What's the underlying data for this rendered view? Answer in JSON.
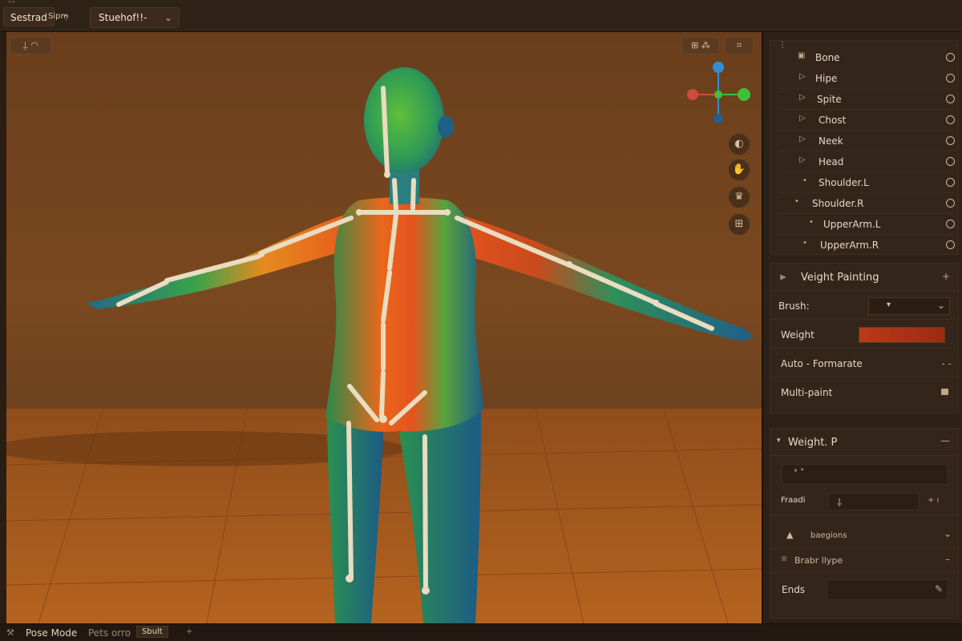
{
  "topbar": {
    "tiny_label": "ᴿᴸᴮ",
    "app_label": "Sestrad",
    "sub_label": "Sipm̴̦",
    "dropdown_value": "Stuehof!!-"
  },
  "viewport": {
    "tl_button_label": "⍊ ◠",
    "tr_button_1": "⊞ ⁂",
    "tr_button_2": "⌗",
    "tools": [
      "◐",
      "✋",
      "♛",
      "⊞"
    ],
    "colors": {
      "axis_x": "#e04a3a",
      "axis_y": "#3fbf3a",
      "axis_z": "#2f8fd6",
      "weight_hot": "#e5531c",
      "weight_mid": "#3aa54a",
      "weight_cold": "#1f5f8a",
      "bone": "#e9dcc0"
    }
  },
  "outliner": {
    "header_mark": "⋮",
    "items": [
      {
        "label": "Bone",
        "mark": "▣"
      },
      {
        "label": "Hipe",
        "mark": "▷"
      },
      {
        "label": "Spite",
        "mark": "▷"
      },
      {
        "label": "Chost",
        "mark": "▷"
      },
      {
        "label": "Neek",
        "mark": "▷"
      },
      {
        "label": "Head",
        "mark": "▷"
      },
      {
        "label": "Shoulder.L",
        "mark": "•"
      },
      {
        "label": "Shoulder.R",
        "mark": "•"
      },
      {
        "label": "UpperArm.L",
        "mark": "•"
      },
      {
        "label": "UpperArm.R",
        "mark": "•"
      }
    ]
  },
  "weight_painting": {
    "title": "Veight Painting",
    "brush_label": "Brush:",
    "brush_value": "▾",
    "weight_label": "Weight",
    "weight_color": "#b83a18",
    "auto_label": "Auto - Formarate",
    "auto_value": "- -",
    "multipaint_label": "Multi-paint"
  },
  "weight_panel": {
    "title": "Weight. P",
    "field1": "°  ˚",
    "fraadi_label": "Fraadi",
    "fraadi_value": "⸸",
    "fraadi_plus": "+ ı",
    "regions_label": "baegions",
    "brabr_label": "Brabr llype",
    "ends_label": "Ends"
  },
  "statusbar": {
    "mode": "Pose Mode",
    "pets": "Pets orro",
    "sbult": "Sbult",
    "plus": "+"
  }
}
